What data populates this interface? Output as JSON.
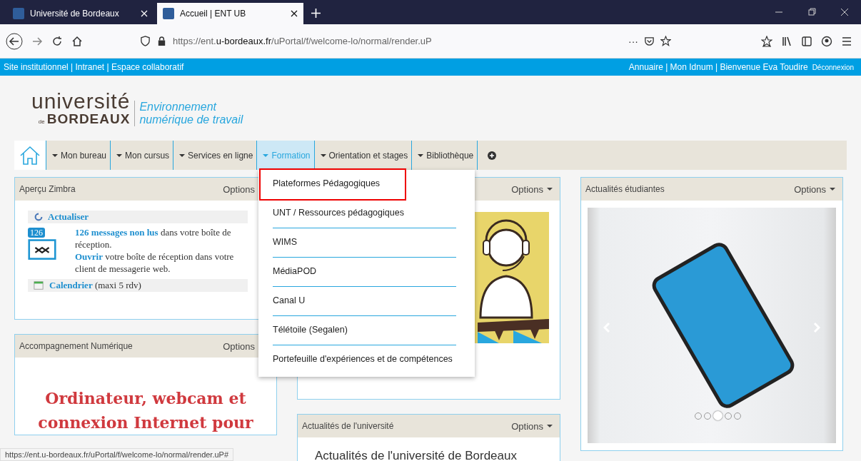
{
  "browser": {
    "tabs": [
      {
        "title": "Université de Bordeaux",
        "selected": false
      },
      {
        "title": "Accueil | ENT UB",
        "selected": true
      }
    ],
    "url": "https://ent.**u-bordeaux.fr**/uPortal/f/welcome-lo/normal/render.uP",
    "page_actions": "···"
  },
  "top_bar": {
    "left": "Site institutionnel | Intranet | Espace collaboratif",
    "right": "Annuaire | Mon Idnum | Bienvenue Eva Toudire",
    "logout": "Déconnexion"
  },
  "logo": {
    "line1": "université",
    "small": "de",
    "line2": "BORDEAUX",
    "subtitle1": "Environnement",
    "subtitle2": "numérique de travail"
  },
  "nav": {
    "items": [
      {
        "label": "Mon bureau",
        "selected": false
      },
      {
        "label": "Mon cursus",
        "selected": false
      },
      {
        "label": "Services en ligne",
        "selected": false
      },
      {
        "label": "Formation",
        "selected": true
      },
      {
        "label": "Orientation et stages",
        "selected": false
      },
      {
        "label": "Bibliothèque",
        "selected": false
      }
    ]
  },
  "dropdown": {
    "items": [
      {
        "label": "Plateformes Pédagogiques",
        "highlighted": true
      },
      {
        "label": "UNT / Ressources pédagogiques",
        "highlighted": false
      },
      {
        "label": "WIMS",
        "highlighted": false
      },
      {
        "label": "MédiaPOD",
        "highlighted": false
      },
      {
        "label": "Canal U",
        "highlighted": false
      },
      {
        "label": "Télétoile (Segalen)",
        "highlighted": false
      },
      {
        "label": "Portefeuille d'expériences et de compétences",
        "highlighted": false
      }
    ]
  },
  "zimbra": {
    "title": "Aperçu Zimbra",
    "options": "Options",
    "refresh": "Actualiser",
    "badge": "126",
    "unread_link": "126 messages non lus",
    "unread_text": " dans votre boîte de réception.",
    "open_link": "Ouvrir",
    "open_text": " votre boîte de réception dans votre client de messagerie web.",
    "calendar_link": "Calendrier",
    "calendar_text": " (maxi 5 rdv)"
  },
  "accompagnement": {
    "title": "Accompagnement Numérique",
    "options": "Options",
    "headline": "Ordinateur, webcam et connexion Internet pour"
  },
  "middle_card": {
    "options": "Options"
  },
  "news_univ": {
    "title": "Actualités de l'université",
    "options": "Options",
    "heading": "Actualités de l'université de Bordeaux"
  },
  "news_students": {
    "title": "Actualités étudiantes",
    "options": "Options",
    "dots": [
      {
        "selected": false
      },
      {
        "selected": false
      },
      {
        "selected": true
      },
      {
        "selected": false
      },
      {
        "selected": false
      }
    ]
  },
  "status_url": "https://ent.u-bordeaux.fr/uPortal/f/welcome-lo/normal/render.uP#"
}
